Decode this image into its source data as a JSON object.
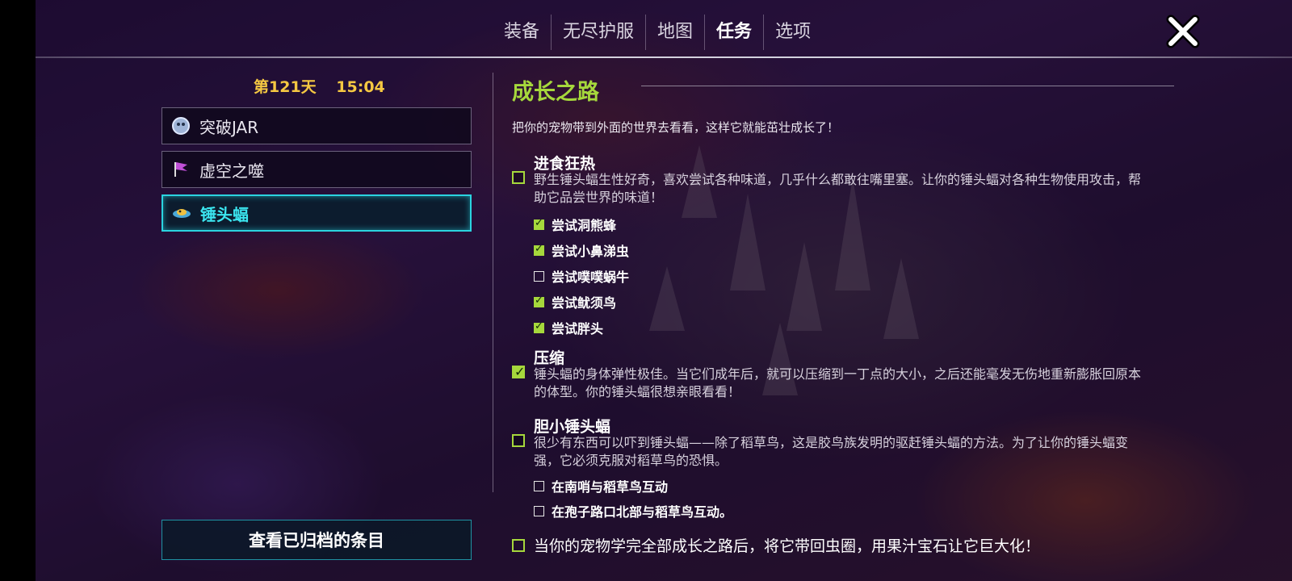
{
  "nav": {
    "tabs": [
      {
        "label": "装备",
        "active": false
      },
      {
        "label": "无尽护服",
        "active": false
      },
      {
        "label": "地图",
        "active": false
      },
      {
        "label": "任务",
        "active": true
      },
      {
        "label": "选项",
        "active": false
      }
    ],
    "close_icon": "close-x-icon"
  },
  "sidebar": {
    "day": "第121天",
    "time": "15:04",
    "quests": [
      {
        "label": "突破JAR",
        "icon": "jar-icon",
        "selected": false
      },
      {
        "label": "虚空之噬",
        "icon": "void-flag-icon",
        "selected": false
      },
      {
        "label": "锤头蝠",
        "icon": "hammerbat-icon",
        "selected": true
      }
    ],
    "archive_button": "查看已归档的条目"
  },
  "quest": {
    "title": "成长之路",
    "description": "把你的宠物带到外面的世界去看看，这样它就能茁壮成长了！",
    "objectives": [
      {
        "title": "进食狂热",
        "desc": "野生锤头蝠生性好奇，喜欢尝试各种味道，几乎什么都敢往嘴里塞。让你的锤头蝠对各种生物使用攻击，帮助它品尝世界的味道！",
        "checked": false,
        "subs": [
          {
            "label": "尝试洞熊蜂",
            "checked": true
          },
          {
            "label": "尝试小鼻涕虫",
            "checked": true
          },
          {
            "label": "尝试噗噗蜗牛",
            "checked": false
          },
          {
            "label": "尝试鱿须鸟",
            "checked": true
          },
          {
            "label": "尝试胖头",
            "checked": true
          }
        ]
      },
      {
        "title": "压缩",
        "desc": "锤头蝠的身体弹性极佳。当它们成年后，就可以压缩到一丁点的大小，之后还能毫发无伤地重新膨胀回原本的体型。你的锤头蝠很想亲眼看看！",
        "checked": true,
        "subs": []
      },
      {
        "title": "胆小锤头蝠",
        "desc": "很少有东西可以吓到锤头蝠——除了稻草鸟，这是胶鸟族发明的驱赶锤头蝠的方法。为了让你的锤头蝠变强，它必须克服对稻草鸟的恐惧。",
        "checked": false,
        "subs": [
          {
            "label": "在南哨与稻草鸟互动",
            "checked": false
          },
          {
            "label": "在孢子路口北部与稻草鸟互动。",
            "checked": false
          }
        ]
      }
    ],
    "final": {
      "label": "当你的宠物学完全部成长之路后，将它带回虫圈，用果汁宝石让它巨大化！",
      "checked": false
    }
  },
  "colors": {
    "accent_green": "#a6d83c",
    "selected_cyan": "#2bd4e0",
    "day_yellow": "#f5c842"
  }
}
